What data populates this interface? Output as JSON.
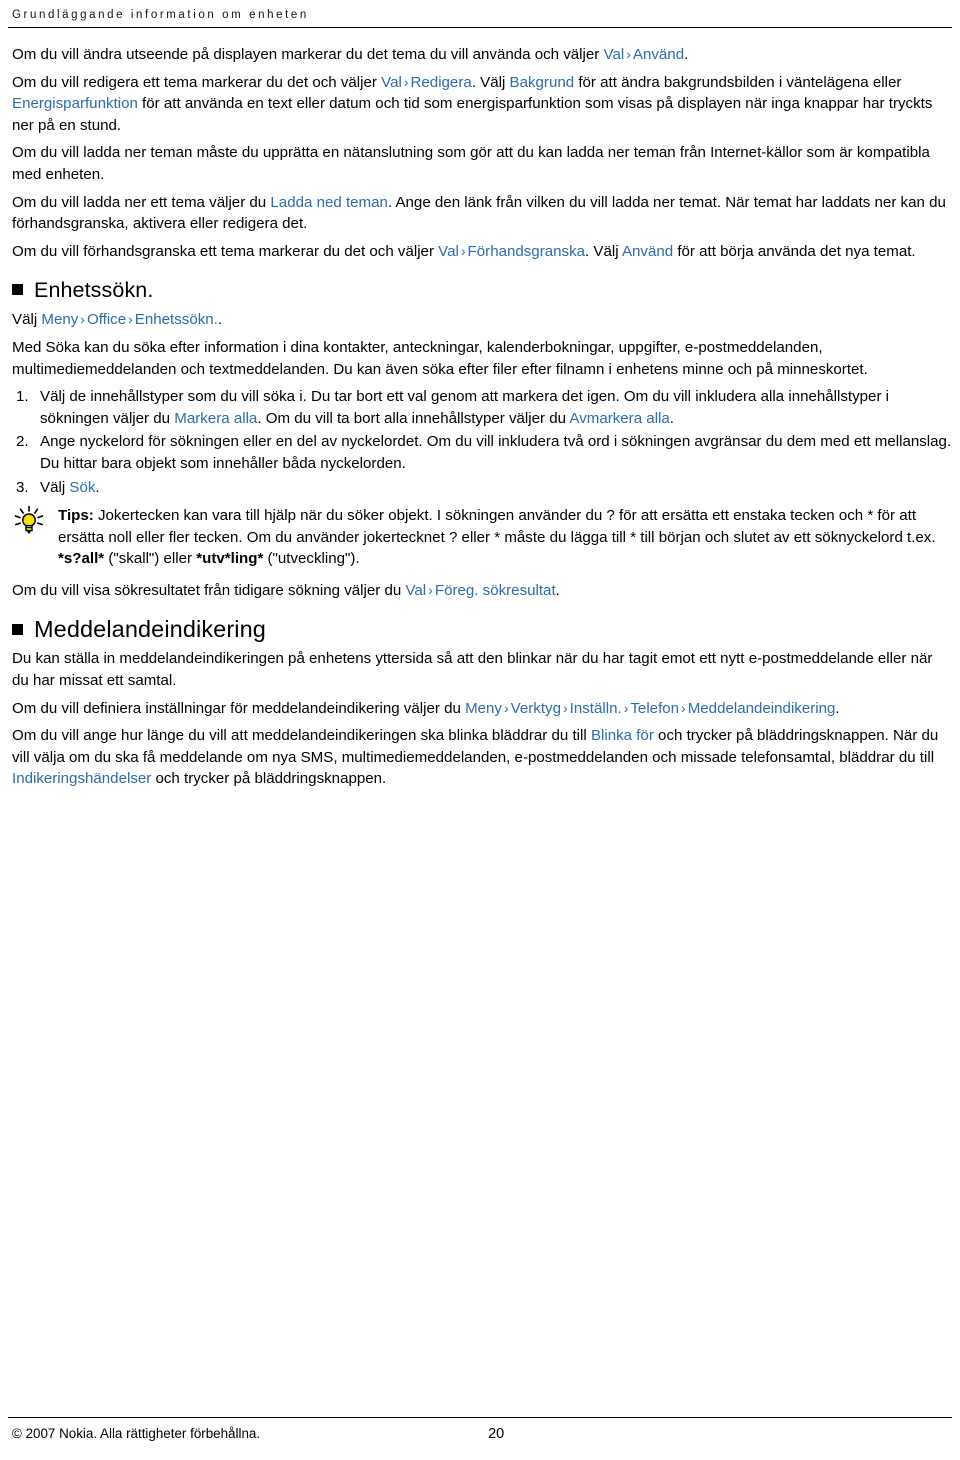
{
  "header": {
    "running_title": "Grundläggande information om enheten"
  },
  "arrow_separator": "›",
  "colors": {
    "link": "#2d6ca8",
    "text": "#000000",
    "tip_bulb": "#f2e20a"
  },
  "content": {
    "p1": {
      "a": "Om du vill ändra utseende på displayen markerar du det tema du vill använda och väljer ",
      "link1": "Val",
      "link2": "Använd",
      "b": "."
    },
    "p2": {
      "a": "Om du vill redigera ett tema markerar du det och väljer ",
      "link1": "Val",
      "link2": "Redigera",
      "b": ". Välj ",
      "link3": "Bakgrund",
      "c": " för att ändra bakgrundsbilden i väntelägena eller ",
      "link4": "Energisparfunktion",
      "d": " för att använda en text eller datum och tid som energisparfunktion som visas på displayen när inga knappar har tryckts ner på en stund."
    },
    "p3": "Om du vill ladda ner teman måste du upprätta en nätanslutning som gör att du kan ladda ner teman från Internet-källor som är kompatibla med enheten.",
    "p4": {
      "a": "Om du vill ladda ner ett tema väljer du ",
      "link1": "Ladda ned teman",
      "b": ". Ange den länk från vilken du vill ladda ner temat. När temat har laddats ner kan du förhandsgranska, aktivera eller redigera det."
    },
    "p5": {
      "a": "Om du vill förhandsgranska ett tema markerar du det och väljer ",
      "link1": "Val",
      "link2": "Förhandsgranska",
      "b": ". Välj ",
      "link3": "Använd",
      "c": " för att börja använda det nya temat."
    },
    "section1": {
      "heading": "Enhetssökn.",
      "path_prefix": "Välj ",
      "path1": "Meny",
      "path2": "Office",
      "path3": "Enhetssökn.",
      "path_suffix": ".",
      "intro": "Med Söka kan du söka efter information i dina kontakter, anteckningar, kalenderbokningar, uppgifter, e-postmeddelanden, multimediemeddelanden och textmeddelanden. Du kan även söka efter filer efter filnamn i enhetens minne och på minneskortet.",
      "steps": {
        "step1": {
          "a": "Välj de innehållstyper som du vill söka i. Du tar bort ett val genom att markera det igen. Om du vill inkludera alla innehållstyper i sökningen väljer du ",
          "link1": "Markera alla",
          "b": ". Om du vill ta bort alla innehållstyper väljer du ",
          "link2": "Avmarkera alla",
          "c": "."
        },
        "step2": "Ange nyckelord för sökningen eller en del av nyckelordet. Om du vill inkludera två ord i sökningen avgränsar du dem med ett mellanslag. Du hittar bara objekt som innehåller båda nyckelorden.",
        "step3": {
          "a": "Välj ",
          "link1": "Sök",
          "b": "."
        }
      },
      "tip": {
        "label": "Tips:",
        "a": " Jokertecken kan vara till hjälp när du söker objekt. I sökningen använder du ? för att ersätta ett enstaka tecken och * för att ersätta noll eller fler tecken. Om du använder jokertecknet ? eller * måste du lägga till * till början och slutet av ett söknyckelord t.ex. ",
        "bold1": "*s?all*",
        "b": " (\"skall\") eller ",
        "bold2": "*utv*ling*",
        "c": " (\"utveckling\")."
      },
      "after_tip": {
        "a": "Om du vill visa sökresultatet från tidigare sökning väljer du ",
        "link1": "Val",
        "link2": "Föreg. sökresultat",
        "b": "."
      }
    },
    "section2": {
      "heading": "Meddelandeindikering",
      "p1": "Du kan ställa in meddelandeindikeringen på enhetens yttersida så att den blinkar när du har tagit emot ett nytt e-postmeddelande eller när du har missat ett samtal.",
      "p2": {
        "a": "Om du vill definiera inställningar för meddelandeindikering väljer du ",
        "link1": "Meny",
        "link2": "Verktyg",
        "link3": "Inställn.",
        "link4": "Telefon",
        "link5": "Meddelandeindikering",
        "b": "."
      },
      "p3": {
        "a": "Om du vill ange hur länge du vill att meddelandeindikeringen ska blinka bläddrar du till ",
        "link1": "Blinka för",
        "b": " och trycker på bläddringsknappen. När du vill välja om du ska få meddelande om nya SMS, multimediemeddelanden, e-postmeddelanden och missade telefonsamtal, bläddrar du till ",
        "link2": "Indikeringshändelser",
        "c": " och trycker på bläddringsknappen."
      }
    }
  },
  "footer": {
    "copyright": "© 2007 Nokia. Alla rättigheter förbehållna.",
    "page_number": "20"
  }
}
